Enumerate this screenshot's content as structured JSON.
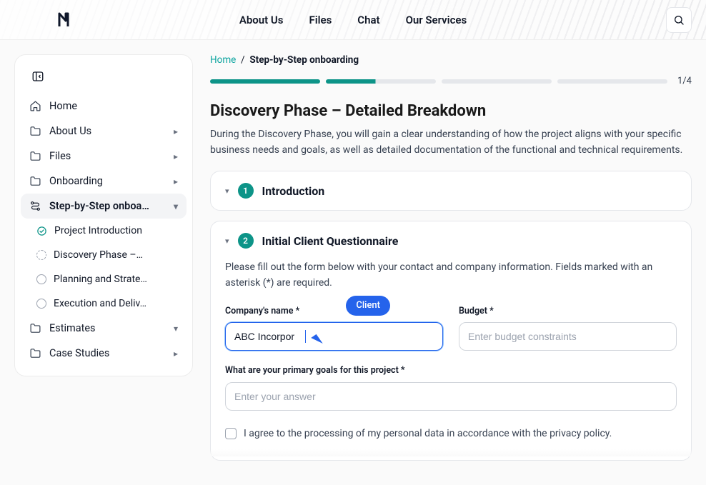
{
  "topnav": {
    "items": [
      "About Us",
      "Files",
      "Chat",
      "Our Services"
    ]
  },
  "breadcrumb": {
    "home": "Home",
    "current": "Step-by-Step onboarding"
  },
  "progress": {
    "label": "1/4"
  },
  "page": {
    "title": "Discovery Phase – Detailed Breakdown",
    "desc": "During the Discovery Phase, you will gain a clear understanding of how the project aligns with your specific business needs and goals, as well as detailed documentation of the functional and technical requirements."
  },
  "sidebar": {
    "items": [
      {
        "label": "Home"
      },
      {
        "label": "About Us"
      },
      {
        "label": "Files"
      },
      {
        "label": "Onboarding"
      },
      {
        "label": "Step-by-Step onboa…"
      },
      {
        "label": "Project Introduction"
      },
      {
        "label": "Discovery Phase –…"
      },
      {
        "label": "Planning and Strate…"
      },
      {
        "label": "Execution and Deliv…"
      },
      {
        "label": "Estimates"
      },
      {
        "label": "Case Studies"
      }
    ]
  },
  "steps": {
    "s1": {
      "num": "1",
      "title": "Introduction"
    },
    "s2": {
      "num": "2",
      "title": "Initial Client Questionnaire",
      "intro": "Please fill out the form below with your contact and company information. Fields marked with an asterisk (*) are required.",
      "company_label": "Company's name *",
      "company_value": "ABC Incorpor",
      "budget_label": "Budget *",
      "budget_placeholder": "Enter budget constraints",
      "goals_label": "What are your primary goals for this project *",
      "goals_placeholder": "Enter your answer",
      "consent": "I agree to the processing of my personal data in accordance with the privacy policy."
    }
  },
  "cursor_label": "Client"
}
